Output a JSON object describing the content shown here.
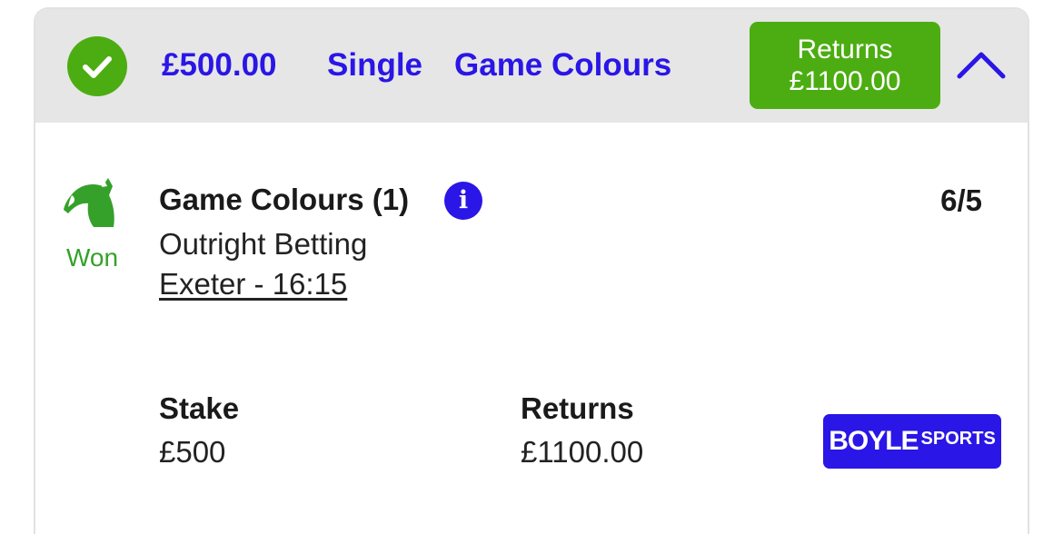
{
  "header": {
    "stake": "£500.00",
    "bet_type": "Single",
    "selection": "Game Colours",
    "returns_label": "Returns",
    "returns_value": "£1100.00"
  },
  "selection": {
    "status": "Won",
    "name": "Game Colours (1)",
    "info_glyph": "i",
    "odds": "6/5",
    "market": "Outright Betting",
    "event": "Exeter - 16:15"
  },
  "summary": {
    "stake_label": "Stake",
    "stake_value": "£500",
    "returns_label": "Returns",
    "returns_value": "£1100.00"
  },
  "brand": {
    "main": "BOYLE",
    "sub": "SPORTS"
  },
  "icons": {
    "status": "check-circle-icon",
    "collapse": "chevron-up-icon",
    "sport": "horse-head-icon",
    "info": "info-icon"
  },
  "colors": {
    "accent_blue": "#2a16e6",
    "win_green": "#4cad12",
    "won_text_green": "#35a12a",
    "header_bg": "#e6e6e6"
  }
}
